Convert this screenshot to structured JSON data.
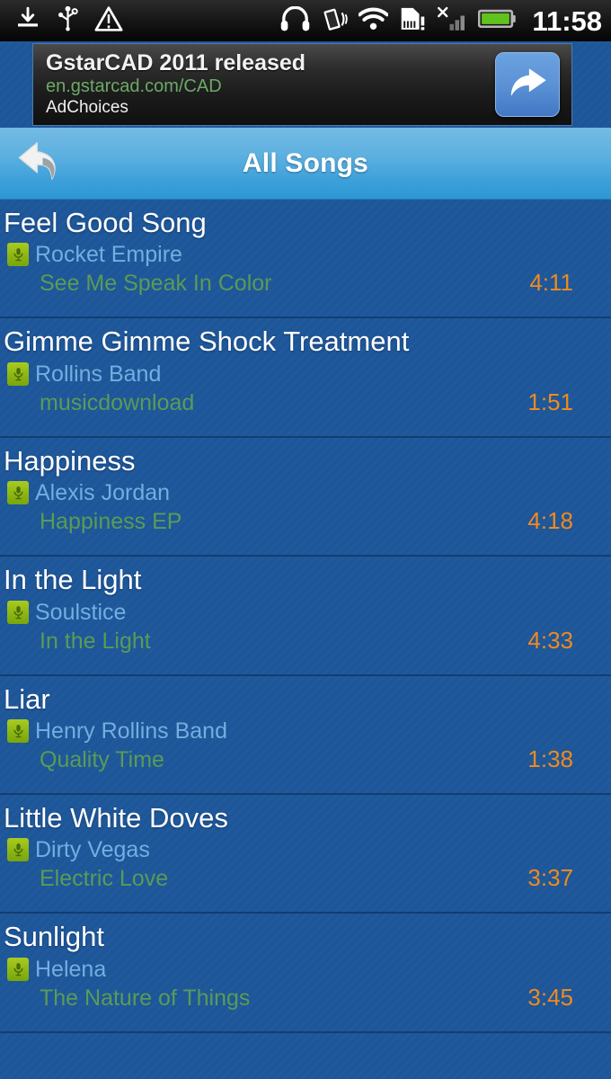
{
  "status_bar": {
    "icons_left": [
      "download-icon",
      "usb-icon",
      "warning-triangle-icon"
    ],
    "icons_right": [
      "headphones-icon",
      "vibrate-icon",
      "wifi-icon",
      "sim-card-warning-icon",
      "signal-bars-no-service-icon",
      "battery-icon"
    ],
    "clock": "11:58"
  },
  "ad": {
    "title": "GstarCAD 2011 released",
    "url": "en.gstarcad.com/CAD",
    "choices_label": "AdChoices",
    "action_icon": "forward-arrow-icon"
  },
  "title_bar": {
    "back_icon": "back-arrow-icon",
    "title": "All Songs"
  },
  "colors": {
    "list_background": "#1d5699",
    "title_bar_top": "#75bbe4",
    "title_bar_bottom": "#2c97d4",
    "song_title": "#ffffff",
    "artist": "#74aee0",
    "album": "#5a9b56",
    "duration": "#f08a1e",
    "mic_icon": "#8ab413",
    "separator": "#133e70",
    "ad_url": "#6ca966"
  },
  "songs": [
    {
      "title": "Feel Good Song",
      "artist": "Rocket Empire",
      "album": "See Me Speak In Color",
      "duration": "4:11",
      "artist_icon": "microphone-icon"
    },
    {
      "title": "Gimme Gimme Shock Treatment",
      "artist": "Rollins Band",
      "album": "musicdownload",
      "duration": "1:51",
      "artist_icon": "microphone-icon"
    },
    {
      "title": "Happiness",
      "artist": "Alexis Jordan",
      "album": "Happiness EP",
      "duration": "4:18",
      "artist_icon": "microphone-icon"
    },
    {
      "title": "In the Light",
      "artist": "Soulstice",
      "album": "In the Light",
      "duration": "4:33",
      "artist_icon": "microphone-icon"
    },
    {
      "title": "Liar",
      "artist": "Henry Rollins Band",
      "album": "Quality Time",
      "duration": "1:38",
      "artist_icon": "microphone-icon"
    },
    {
      "title": "Little White Doves",
      "artist": "Dirty Vegas",
      "album": "Electric Love",
      "duration": "3:37",
      "artist_icon": "microphone-icon"
    },
    {
      "title": "Sunlight",
      "artist": "Helena",
      "album": "The Nature of Things",
      "duration": "3:45",
      "artist_icon": "microphone-icon"
    }
  ]
}
